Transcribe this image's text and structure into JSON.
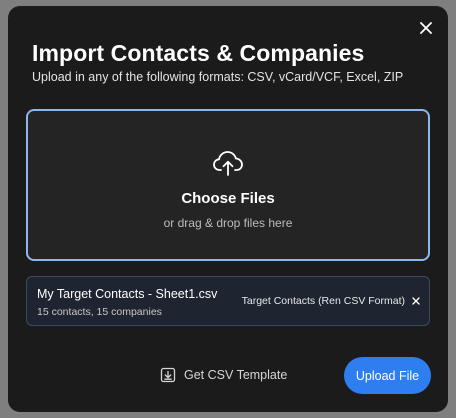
{
  "dialog": {
    "title": "Import Contacts & Companies",
    "subtitle": "Upload in any of the following formats: CSV, vCard/VCF, Excel, ZIP",
    "close_icon": "close-icon"
  },
  "dropzone": {
    "icon": "cloud-upload-icon",
    "title": "Choose Files",
    "hint": "or drag & drop files here",
    "border_color": "#8fb7e6"
  },
  "files": [
    {
      "name": "My Target Contacts - Sheet1.csv",
      "meta": "15 contacts, 15 companies",
      "format": "Target Contacts (Ren CSV Format)",
      "remove_icon": "remove-icon"
    }
  ],
  "footer": {
    "template_icon": "download-icon",
    "template_label": "Get CSV Template",
    "upload_label": "Upload File",
    "accent_color": "#2f7ef0"
  }
}
